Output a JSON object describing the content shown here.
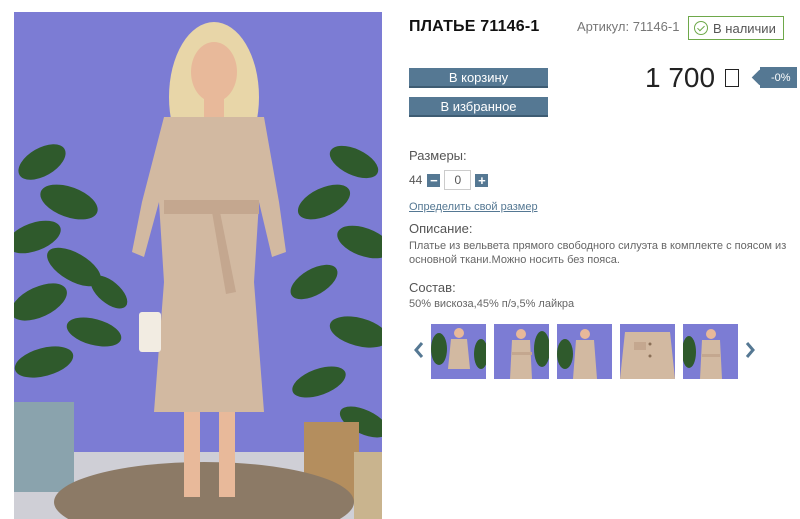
{
  "product": {
    "title": "ПЛАТЬЕ 71146-1",
    "sku": "Артикул: 71146-1",
    "stock": "В наличии"
  },
  "buttons": {
    "cart": "В корзину",
    "favorites": "В избранное"
  },
  "price": {
    "value": "1 700",
    "discount": "-0%"
  },
  "sizes": {
    "label": "Размеры:",
    "size": "44",
    "quantity": "0",
    "link": "Определить свой размер"
  },
  "description": {
    "label": "Описание:",
    "text": "Платье из вельвета прямого свободного силуэта в комплекте с поясом из основной ткани.Можно носить без пояса."
  },
  "composition": {
    "label": "Состав:",
    "text": "50% вискоза,45% п/э,5% лайкра"
  },
  "colors": {
    "accent": "#557893",
    "stock_border": "#6ea84a",
    "photo_background": "#7c7cd4",
    "dress": "#d2b9a1"
  },
  "icons": {
    "stock": "check-circle-icon",
    "currency": "ruble-icon",
    "prev": "chevron-left-icon",
    "next": "chevron-right-icon"
  }
}
